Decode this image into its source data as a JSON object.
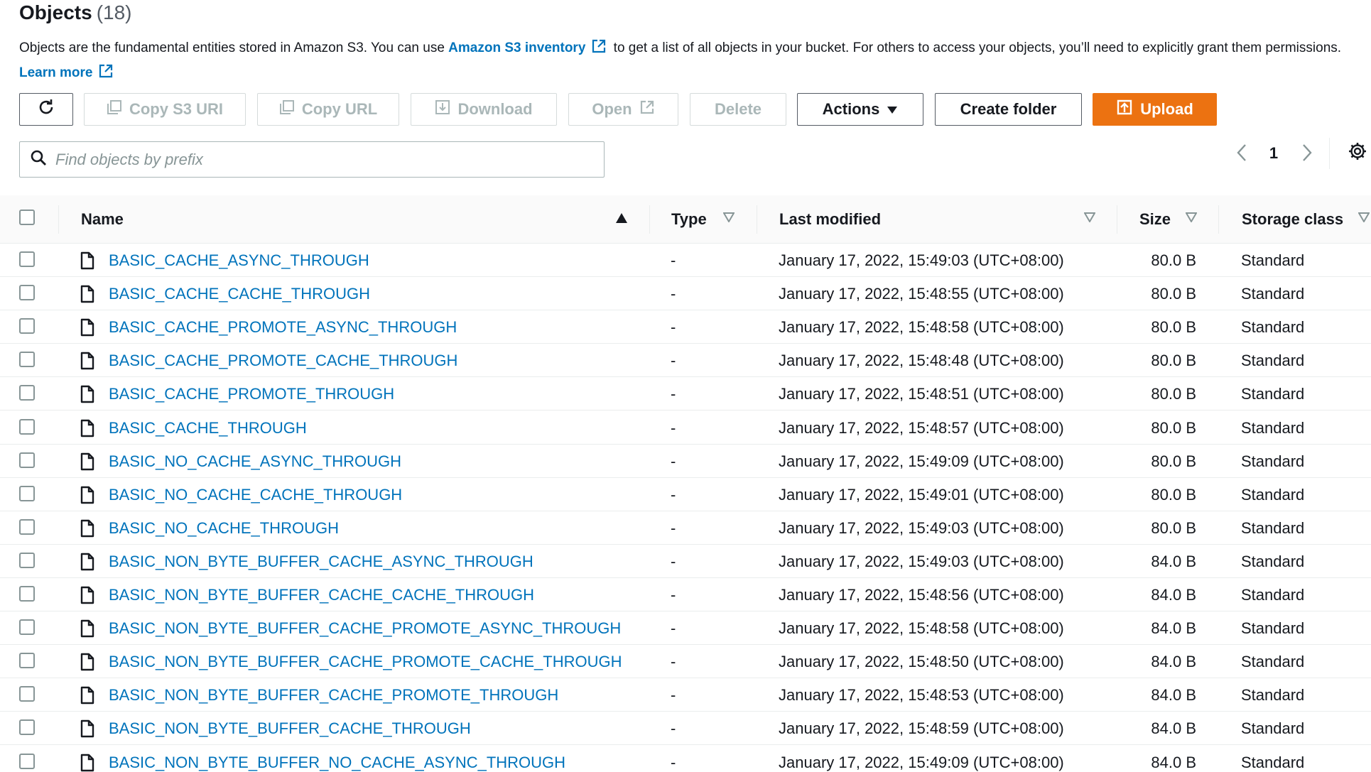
{
  "header": {
    "title": "Objects",
    "count": "(18)"
  },
  "description": {
    "part1": "Objects are the fundamental entities stored in Amazon S3. You can use ",
    "inventory_link": "Amazon S3 inventory",
    "part2": " to get a list of all objects in your bucket. For others to access your objects, you’ll need to explicitly grant them permissions. ",
    "learn_more": "Learn more"
  },
  "toolbar": {
    "copy_s3_uri": "Copy S3 URI",
    "copy_url": "Copy URL",
    "download": "Download",
    "open": "Open",
    "delete": "Delete",
    "actions": "Actions",
    "create_folder": "Create folder",
    "upload": "Upload"
  },
  "search": {
    "placeholder": "Find objects by prefix"
  },
  "pagination": {
    "page": "1"
  },
  "columns": {
    "name": "Name",
    "type": "Type",
    "last_modified": "Last modified",
    "size": "Size",
    "storage_class": "Storage class"
  },
  "colors": {
    "link": "#0073bb",
    "primary": "#ec7211",
    "border": "#aab7b8",
    "disabled": "#aab7b8"
  },
  "icons": [
    "refresh-icon",
    "copy-icon",
    "download-icon",
    "external-link-icon",
    "caret-down-icon",
    "upload-icon",
    "search-icon",
    "chevron-left-icon",
    "chevron-right-icon",
    "gear-icon",
    "sort-ascending-icon",
    "sort-descending-icon",
    "file-icon"
  ],
  "rows": [
    {
      "name": "BASIC_CACHE_ASYNC_THROUGH",
      "type": "-",
      "last_modified": "January 17, 2022, 15:49:03 (UTC+08:00)",
      "size": "80.0 B",
      "storage_class": "Standard"
    },
    {
      "name": "BASIC_CACHE_CACHE_THROUGH",
      "type": "-",
      "last_modified": "January 17, 2022, 15:48:55 (UTC+08:00)",
      "size": "80.0 B",
      "storage_class": "Standard"
    },
    {
      "name": "BASIC_CACHE_PROMOTE_ASYNC_THROUGH",
      "type": "-",
      "last_modified": "January 17, 2022, 15:48:58 (UTC+08:00)",
      "size": "80.0 B",
      "storage_class": "Standard"
    },
    {
      "name": "BASIC_CACHE_PROMOTE_CACHE_THROUGH",
      "type": "-",
      "last_modified": "January 17, 2022, 15:48:48 (UTC+08:00)",
      "size": "80.0 B",
      "storage_class": "Standard"
    },
    {
      "name": "BASIC_CACHE_PROMOTE_THROUGH",
      "type": "-",
      "last_modified": "January 17, 2022, 15:48:51 (UTC+08:00)",
      "size": "80.0 B",
      "storage_class": "Standard"
    },
    {
      "name": "BASIC_CACHE_THROUGH",
      "type": "-",
      "last_modified": "January 17, 2022, 15:48:57 (UTC+08:00)",
      "size": "80.0 B",
      "storage_class": "Standard"
    },
    {
      "name": "BASIC_NO_CACHE_ASYNC_THROUGH",
      "type": "-",
      "last_modified": "January 17, 2022, 15:49:09 (UTC+08:00)",
      "size": "80.0 B",
      "storage_class": "Standard"
    },
    {
      "name": "BASIC_NO_CACHE_CACHE_THROUGH",
      "type": "-",
      "last_modified": "January 17, 2022, 15:49:01 (UTC+08:00)",
      "size": "80.0 B",
      "storage_class": "Standard"
    },
    {
      "name": "BASIC_NO_CACHE_THROUGH",
      "type": "-",
      "last_modified": "January 17, 2022, 15:49:03 (UTC+08:00)",
      "size": "80.0 B",
      "storage_class": "Standard"
    },
    {
      "name": "BASIC_NON_BYTE_BUFFER_CACHE_ASYNC_THROUGH",
      "type": "-",
      "last_modified": "January 17, 2022, 15:49:03 (UTC+08:00)",
      "size": "84.0 B",
      "storage_class": "Standard"
    },
    {
      "name": "BASIC_NON_BYTE_BUFFER_CACHE_CACHE_THROUGH",
      "type": "-",
      "last_modified": "January 17, 2022, 15:48:56 (UTC+08:00)",
      "size": "84.0 B",
      "storage_class": "Standard"
    },
    {
      "name": "BASIC_NON_BYTE_BUFFER_CACHE_PROMOTE_ASYNC_THROUGH",
      "type": "-",
      "last_modified": "January 17, 2022, 15:48:58 (UTC+08:00)",
      "size": "84.0 B",
      "storage_class": "Standard"
    },
    {
      "name": "BASIC_NON_BYTE_BUFFER_CACHE_PROMOTE_CACHE_THROUGH",
      "type": "-",
      "last_modified": "January 17, 2022, 15:48:50 (UTC+08:00)",
      "size": "84.0 B",
      "storage_class": "Standard"
    },
    {
      "name": "BASIC_NON_BYTE_BUFFER_CACHE_PROMOTE_THROUGH",
      "type": "-",
      "last_modified": "January 17, 2022, 15:48:53 (UTC+08:00)",
      "size": "84.0 B",
      "storage_class": "Standard"
    },
    {
      "name": "BASIC_NON_BYTE_BUFFER_CACHE_THROUGH",
      "type": "-",
      "last_modified": "January 17, 2022, 15:48:59 (UTC+08:00)",
      "size": "84.0 B",
      "storage_class": "Standard"
    },
    {
      "name": "BASIC_NON_BYTE_BUFFER_NO_CACHE_ASYNC_THROUGH",
      "type": "-",
      "last_modified": "January 17, 2022, 15:49:09 (UTC+08:00)",
      "size": "84.0 B",
      "storage_class": "Standard"
    }
  ]
}
